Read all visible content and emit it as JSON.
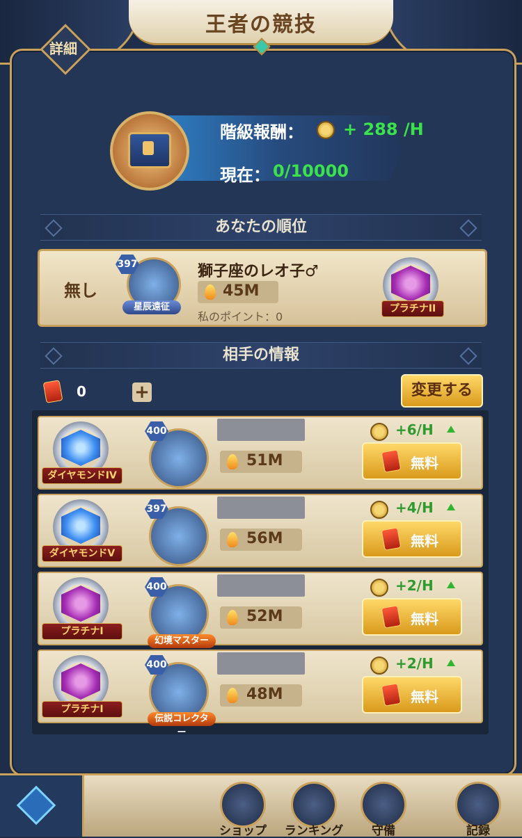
{
  "header": {
    "title": "王者の競技",
    "detail_label": "詳細"
  },
  "reward": {
    "label": "階級報酬：",
    "rate": "+ 288 /H",
    "current_label": "現在：",
    "current_value": "0/10000"
  },
  "my_rank": {
    "section_title": "あなたの順位",
    "rank": "無し",
    "level": "397",
    "title_tag": "星辰遠征",
    "name": "獅子座のレオ子♂",
    "power": "45M",
    "points": "私のポイント：0",
    "tier": "プラチナII"
  },
  "opponents_section": {
    "title": "相手の情報",
    "ticket_count": "0",
    "plus_label": "+",
    "change_label": "変更する"
  },
  "opponents": [
    {
      "tier": "ダイヤモンドIV",
      "level": "400",
      "title_tag": "",
      "power": "51M",
      "rate": "+6/H",
      "free_label": "無料"
    },
    {
      "tier": "ダイヤモンドV",
      "level": "397",
      "title_tag": "",
      "power": "56M",
      "rate": "+4/H",
      "free_label": "無料"
    },
    {
      "tier": "プラチナI",
      "level": "400",
      "title_tag": "幻境マスター",
      "power": "52M",
      "rate": "+2/H",
      "free_label": "無料"
    },
    {
      "tier": "プラチナI",
      "level": "400",
      "title_tag": "伝説コレクター",
      "power": "48M",
      "rate": "+2/H",
      "free_label": "無料"
    }
  ],
  "nav": {
    "items": [
      {
        "label": "ショップ",
        "icon": "bag-icon"
      },
      {
        "label": "ランキング",
        "icon": "banner-icon"
      },
      {
        "label": "守備",
        "icon": "shield-icon"
      },
      {
        "label": "記録",
        "icon": "scroll-icon"
      }
    ]
  },
  "colors": {
    "accent_gold": "#c9a15a",
    "rate_green": "#3ae24c",
    "panel_navy": "#243656"
  }
}
